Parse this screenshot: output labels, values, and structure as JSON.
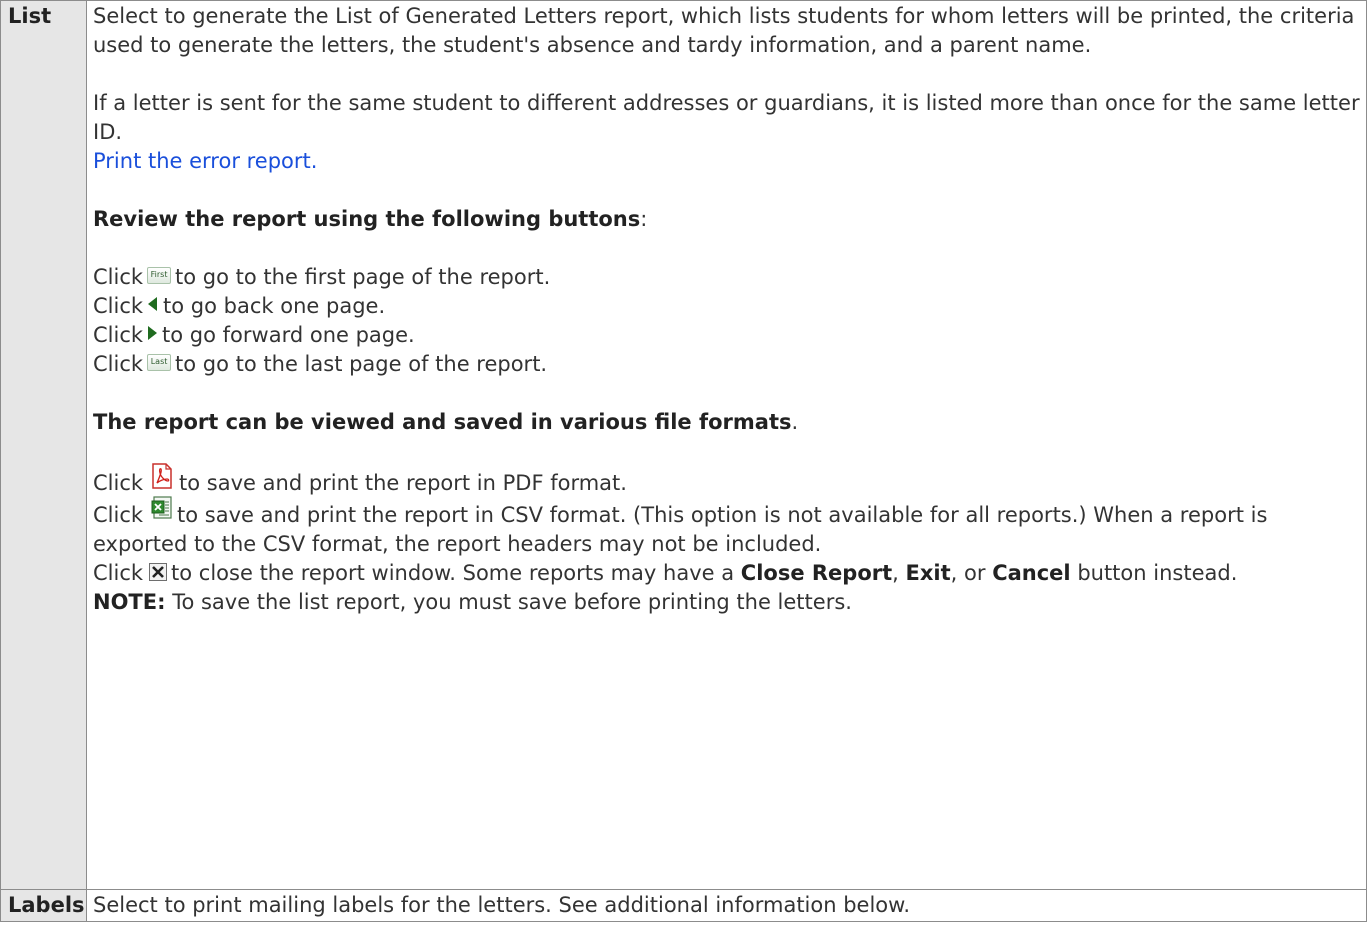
{
  "rows": [
    {
      "term": "List",
      "para1": "Select to generate the List of Generated Letters report, which lists students for whom letters will be printed, the criteria used to generate the letters, the student's absence and tardy information, and a parent name.",
      "para2": "If a letter is sent for the same student to different addresses or guardians, it is listed more than once for the same letter ID.",
      "error_link": "Print the error report.",
      "review_heading": "Review the report using the following buttons",
      "review_colon": ":",
      "click": "Click",
      "nav": [
        {
          "icon": "first-page-button-icon",
          "label": "First",
          "text": "to go to the first page of the report."
        },
        {
          "icon": "previous-page-arrow-icon",
          "text": "to go back one page."
        },
        {
          "icon": "next-page-arrow-icon",
          "text": "to go forward one page."
        },
        {
          "icon": "last-page-button-icon",
          "label": "Last",
          "text": "to go to the last page of the report."
        }
      ],
      "formats_heading": "The report can be viewed and saved in various file formats",
      "formats_period": ".",
      "pdf_text": "to save and print the report in PDF format.",
      "csv_text": "to save and print the report in CSV format. (This option is not available for all reports.) When a report is exported to the CSV format, the report headers may not be included.",
      "close_text_1": "to close the report window. Some reports may have a",
      "close_report": "Close Report",
      "comma": ",",
      "exit": "Exit",
      "or": ", or",
      "cancel": "Cancel",
      "close_text_2": "button instead.",
      "note_label": "NOTE:",
      "note_text": "To save the list report, you must save before printing the letters."
    },
    {
      "term": "Labels",
      "text": "Select to print mailing labels for the letters. See additional information below."
    }
  ],
  "colors": {
    "link": "#1a4fdb",
    "term_bg": "#e6e6e6",
    "border": "#8c8c8c",
    "nav_green": "#1f6b1f"
  }
}
